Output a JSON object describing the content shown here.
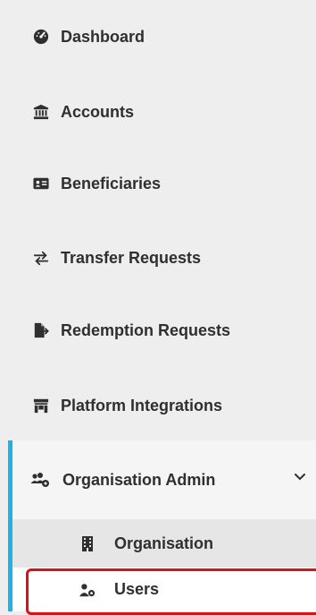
{
  "nav": {
    "items": [
      {
        "label": "Dashboard",
        "icon": "dashboard-icon"
      },
      {
        "label": "Accounts",
        "icon": "bank-icon"
      },
      {
        "label": "Beneficiaries",
        "icon": "id-card-icon"
      },
      {
        "label": "Transfer Requests",
        "icon": "transfer-arrows-icon"
      },
      {
        "label": "Redemption Requests",
        "icon": "file-export-icon"
      },
      {
        "label": "Platform Integrations",
        "icon": "store-icon"
      }
    ],
    "group": {
      "label": "Organisation Admin",
      "icon": "users-gear-icon",
      "expanded": true,
      "chevron": "chevron-down-icon",
      "children": [
        {
          "label": "Organisation",
          "icon": "building-icon"
        },
        {
          "label": "Users",
          "icon": "user-gear-icon",
          "active": true
        }
      ]
    }
  },
  "colors": {
    "accent": "#1eb3e8",
    "highlight": "#e01010",
    "background": "#eeeeee"
  }
}
